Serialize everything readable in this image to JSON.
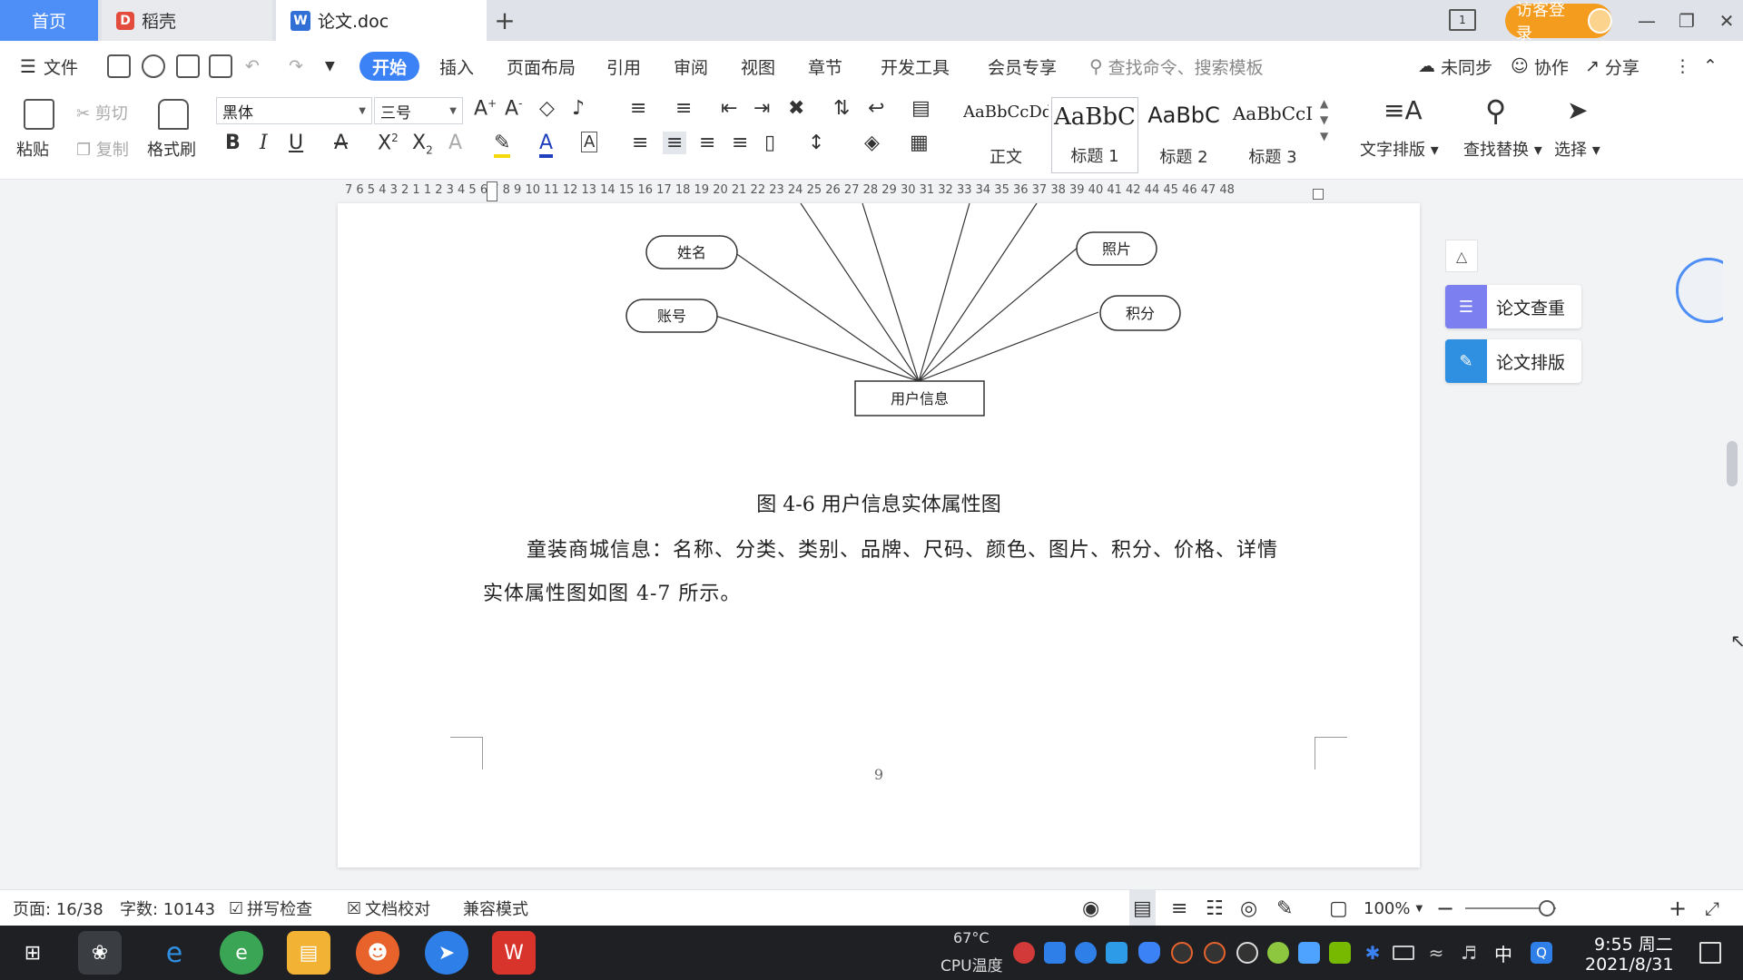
{
  "tabs": {
    "home": "首页",
    "daoke": "稻壳",
    "doc": "论文.doc"
  },
  "titlebar": {
    "window_box_label": "1",
    "login": "访客登录"
  },
  "command_bar": {
    "file": "文件",
    "menus": [
      "开始",
      "插入",
      "页面布局",
      "引用",
      "审阅",
      "视图",
      "章节",
      "开发工具",
      "会员专享"
    ],
    "search_placeholder": "查找命令、搜索模板",
    "sync": "未同步",
    "collab": "协作",
    "share": "分享"
  },
  "ribbon": {
    "paste": "粘贴",
    "cut": "剪切",
    "copy": "复制",
    "format_painter": "格式刷",
    "font_name": "黑体",
    "font_size": "三号",
    "styles": [
      {
        "preview": "AaBbCcDd",
        "name": "正文"
      },
      {
        "preview": "AaBbC",
        "name": "标题 1"
      },
      {
        "preview": "AaBbC",
        "name": "标题 2"
      },
      {
        "preview": "AaBbCcI",
        "name": "标题 3"
      }
    ],
    "text_layout": "文字排版",
    "find_replace": "查找替换",
    "select": "选择"
  },
  "ruler": {
    "numbers": "7  6  5  4  3  2  1      1  2  3  4  5  6  7  8  9  10 11 12 13 14 15 16 17 18 19 20 21 22 23 24 25 26 27 28 29 30 31 32 33 34 35 36 37 38 39 40 41 42    44 45 46 47 48"
  },
  "document": {
    "diagram": {
      "entity": "用户信息",
      "attributes": [
        "姓名",
        "账号",
        "照片",
        "积分"
      ]
    },
    "caption": "图 4-6 用户信息实体属性图",
    "paragraph_line1": "童装商城信息：名称、分类、类别、品牌、尺码、颜色、图片、积分、价格、详情",
    "paragraph_line2": "实体属性图如图 4-7 所示。",
    "page_number": "9"
  },
  "side_panel": {
    "check": "论文查重",
    "layout": "论文排版"
  },
  "statusbar": {
    "page": "页面: 16/38",
    "words": "字数: 10143",
    "spell": "拼写检查",
    "proof": "文档校对",
    "compat": "兼容模式",
    "zoom": "100%",
    "zoom_level_fraction": 0.9
  },
  "taskbar": {
    "temp": "67°C",
    "temp_label": "CPU温度",
    "ime": "中",
    "time": "9:55 周二",
    "date": "2021/8/31"
  },
  "colors": {
    "accent": "#3b82f6",
    "login": "#f39c1e",
    "taskbar": "#1e2024"
  }
}
